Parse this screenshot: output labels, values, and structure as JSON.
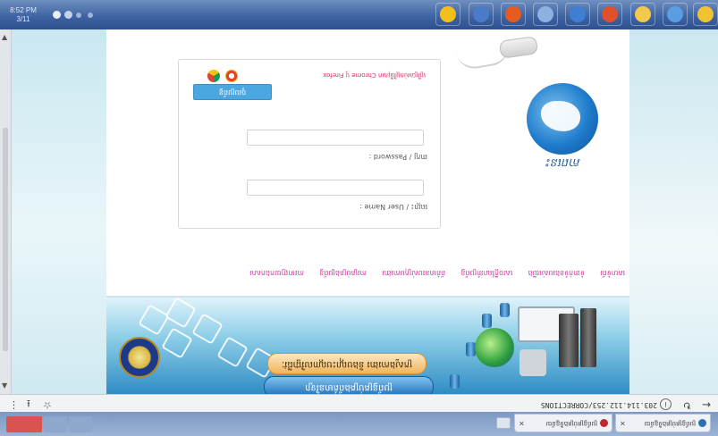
{
  "taskbar": {
    "clock_line1": "8:52 PM",
    "clock_line2": "3/11",
    "pinned_apps": [
      {
        "name": "chrome-icon",
        "color": "#f3c019"
      },
      {
        "name": "photos-icon",
        "color": "#4a7bc9"
      },
      {
        "name": "firefox-icon",
        "color": "#e65b1e"
      },
      {
        "name": "explorer-icon",
        "color": "#8db1e0"
      },
      {
        "name": "ccleaner-icon",
        "color": "#3e7fd3"
      },
      {
        "name": "office-icon",
        "color": "#e0502a"
      },
      {
        "name": "folder-icon",
        "color": "#f2c94c"
      },
      {
        "name": "paint-icon",
        "color": "#5a9de0"
      },
      {
        "name": "ie-icon",
        "color": "#f1c232"
      }
    ]
  },
  "page": {
    "logo_caption": "ភាពនេះ",
    "login": {
      "username_label": "ឈ្មោះ / User Name :",
      "username_value": "",
      "password_label": "ពាក្យ / Password :",
      "password_value": "",
      "submit_label": "ចូលប្រព័ន្ធ",
      "browser_tip": "ប្រើប្រាស់កម្មវិធីរុករក Chrome ឬ Firefox"
    },
    "links": [
      "គេហទំព័រ",
      "ទំនាក់ទំនងរបស់យើង",
      "សេចក្ដីណែនាំប្រព័ន្ធ",
      "ព័ត៌មានរបស់ក្រុមការងារ",
      "ការគ្រប់គ្រងប្រព័ន្ធ",
      "ការទាញយកឯកសារ"
    ],
    "banner": {
      "title_line1": "ប្រព័ន្ធគ្រប់គ្រងព័ត៌មានវិទ្យា",
      "title_line2": "ក្រសួងការងារ និងបណ្តុះបណ្តាលវិជ្ជាជីវៈ"
    }
  },
  "browser": {
    "url": "203.114.112.253/CORRECTIONS",
    "tabs": [
      {
        "title": "ប្រព័ន្ធគ្រប់គ្រងទិន្នន័យ",
        "favicon_color": "#2f6fb5"
      },
      {
        "title": "ប្រព័ន្ធគ្រប់គ្រងទិន្នន័យ",
        "favicon_color": "#c1272d"
      }
    ]
  }
}
